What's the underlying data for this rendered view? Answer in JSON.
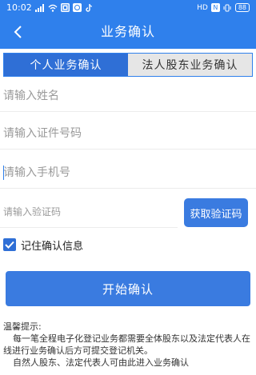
{
  "status_bar": {
    "time": "10:02",
    "network_label": "HD",
    "nfc_label": "N",
    "battery_level": "88"
  },
  "nav": {
    "title": "业务确认",
    "back_icon": "chevron-left-icon"
  },
  "tabs": [
    {
      "label": "个人业务确认",
      "active": true
    },
    {
      "label": "法人股东业务确认",
      "active": false
    }
  ],
  "form": {
    "name_placeholder": "请输入姓名",
    "id_placeholder": "请输入证件号码",
    "phone_placeholder": "请输入手机号",
    "code_placeholder": "请输入验证码",
    "get_code_label": "获取验证码",
    "remember_label": "记住确认信息",
    "remember_checked": true,
    "submit_label": "开始确认"
  },
  "tips": {
    "title": "温馨提示:",
    "line1": "每一笔全程电子化登记业务都需要全体股东以及法定代表人在线进行业务确认后方可提交登记机关。",
    "line2": "自然人股东、法定代表人可由此进入业务确认"
  },
  "colors": {
    "brand_blue": "#2f80ec",
    "button_blue": "#3a7be0",
    "tab_active": "#2f6fd6",
    "tab_inactive": "#e6e6e6"
  }
}
